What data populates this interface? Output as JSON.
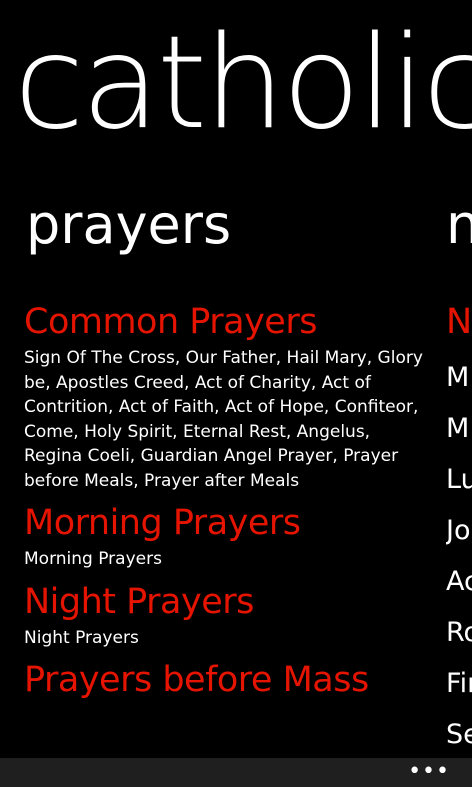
{
  "app": {
    "title": "catholic"
  },
  "pivot": {
    "current": "prayers",
    "next": "n"
  },
  "prayers": [
    {
      "title": "Common Prayers",
      "description": "Sign Of The Cross, Our Father, Hail Mary, Glory be, Apostles Creed, Act of Charity, Act of Contrition, Act of Faith, Act of Hope, Confiteor, Come, Holy Spirit, Eternal Rest, Angelus, Regina Coeli, Guardian Angel Prayer, Prayer before Meals, Prayer after Meals"
    },
    {
      "title": "Morning Prayers",
      "description": "Morning Prayers"
    },
    {
      "title": "Night Prayers",
      "description": "Night Prayers"
    },
    {
      "title": "Prayers before Mass",
      "description": ""
    }
  ],
  "next_panel": {
    "title": "N",
    "items": [
      "M",
      "M",
      "Lu",
      "Jo",
      "Ac",
      "Ro",
      "Fir",
      "Se"
    ]
  },
  "app_bar": {
    "more_label": "•••"
  },
  "colors": {
    "accent": "#e51400",
    "background": "#000000",
    "app_bar": "#1f1f1f"
  }
}
